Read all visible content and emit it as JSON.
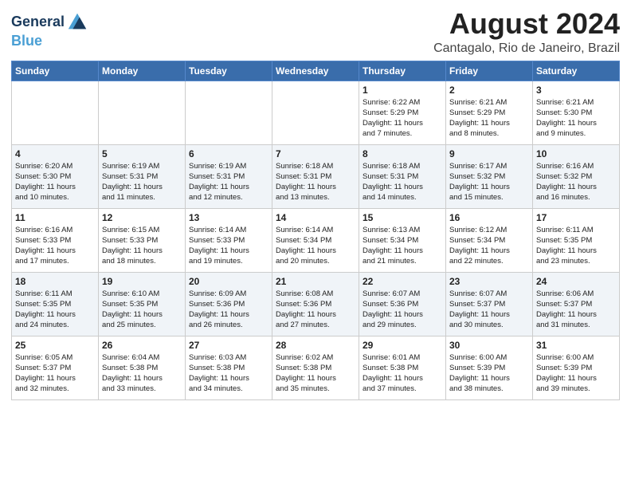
{
  "logo": {
    "line1": "General",
    "line2": "Blue"
  },
  "title": "August 2024",
  "location": "Cantagalo, Rio de Janeiro, Brazil",
  "days_of_week": [
    "Sunday",
    "Monday",
    "Tuesday",
    "Wednesday",
    "Thursday",
    "Friday",
    "Saturday"
  ],
  "weeks": [
    [
      {
        "day": "",
        "info": ""
      },
      {
        "day": "",
        "info": ""
      },
      {
        "day": "",
        "info": ""
      },
      {
        "day": "",
        "info": ""
      },
      {
        "day": "1",
        "info": "Sunrise: 6:22 AM\nSunset: 5:29 PM\nDaylight: 11 hours\nand 7 minutes."
      },
      {
        "day": "2",
        "info": "Sunrise: 6:21 AM\nSunset: 5:29 PM\nDaylight: 11 hours\nand 8 minutes."
      },
      {
        "day": "3",
        "info": "Sunrise: 6:21 AM\nSunset: 5:30 PM\nDaylight: 11 hours\nand 9 minutes."
      }
    ],
    [
      {
        "day": "4",
        "info": "Sunrise: 6:20 AM\nSunset: 5:30 PM\nDaylight: 11 hours\nand 10 minutes."
      },
      {
        "day": "5",
        "info": "Sunrise: 6:19 AM\nSunset: 5:31 PM\nDaylight: 11 hours\nand 11 minutes."
      },
      {
        "day": "6",
        "info": "Sunrise: 6:19 AM\nSunset: 5:31 PM\nDaylight: 11 hours\nand 12 minutes."
      },
      {
        "day": "7",
        "info": "Sunrise: 6:18 AM\nSunset: 5:31 PM\nDaylight: 11 hours\nand 13 minutes."
      },
      {
        "day": "8",
        "info": "Sunrise: 6:18 AM\nSunset: 5:31 PM\nDaylight: 11 hours\nand 14 minutes."
      },
      {
        "day": "9",
        "info": "Sunrise: 6:17 AM\nSunset: 5:32 PM\nDaylight: 11 hours\nand 15 minutes."
      },
      {
        "day": "10",
        "info": "Sunrise: 6:16 AM\nSunset: 5:32 PM\nDaylight: 11 hours\nand 16 minutes."
      }
    ],
    [
      {
        "day": "11",
        "info": "Sunrise: 6:16 AM\nSunset: 5:33 PM\nDaylight: 11 hours\nand 17 minutes."
      },
      {
        "day": "12",
        "info": "Sunrise: 6:15 AM\nSunset: 5:33 PM\nDaylight: 11 hours\nand 18 minutes."
      },
      {
        "day": "13",
        "info": "Sunrise: 6:14 AM\nSunset: 5:33 PM\nDaylight: 11 hours\nand 19 minutes."
      },
      {
        "day": "14",
        "info": "Sunrise: 6:14 AM\nSunset: 5:34 PM\nDaylight: 11 hours\nand 20 minutes."
      },
      {
        "day": "15",
        "info": "Sunrise: 6:13 AM\nSunset: 5:34 PM\nDaylight: 11 hours\nand 21 minutes."
      },
      {
        "day": "16",
        "info": "Sunrise: 6:12 AM\nSunset: 5:34 PM\nDaylight: 11 hours\nand 22 minutes."
      },
      {
        "day": "17",
        "info": "Sunrise: 6:11 AM\nSunset: 5:35 PM\nDaylight: 11 hours\nand 23 minutes."
      }
    ],
    [
      {
        "day": "18",
        "info": "Sunrise: 6:11 AM\nSunset: 5:35 PM\nDaylight: 11 hours\nand 24 minutes."
      },
      {
        "day": "19",
        "info": "Sunrise: 6:10 AM\nSunset: 5:35 PM\nDaylight: 11 hours\nand 25 minutes."
      },
      {
        "day": "20",
        "info": "Sunrise: 6:09 AM\nSunset: 5:36 PM\nDaylight: 11 hours\nand 26 minutes."
      },
      {
        "day": "21",
        "info": "Sunrise: 6:08 AM\nSunset: 5:36 PM\nDaylight: 11 hours\nand 27 minutes."
      },
      {
        "day": "22",
        "info": "Sunrise: 6:07 AM\nSunset: 5:36 PM\nDaylight: 11 hours\nand 29 minutes."
      },
      {
        "day": "23",
        "info": "Sunrise: 6:07 AM\nSunset: 5:37 PM\nDaylight: 11 hours\nand 30 minutes."
      },
      {
        "day": "24",
        "info": "Sunrise: 6:06 AM\nSunset: 5:37 PM\nDaylight: 11 hours\nand 31 minutes."
      }
    ],
    [
      {
        "day": "25",
        "info": "Sunrise: 6:05 AM\nSunset: 5:37 PM\nDaylight: 11 hours\nand 32 minutes."
      },
      {
        "day": "26",
        "info": "Sunrise: 6:04 AM\nSunset: 5:38 PM\nDaylight: 11 hours\nand 33 minutes."
      },
      {
        "day": "27",
        "info": "Sunrise: 6:03 AM\nSunset: 5:38 PM\nDaylight: 11 hours\nand 34 minutes."
      },
      {
        "day": "28",
        "info": "Sunrise: 6:02 AM\nSunset: 5:38 PM\nDaylight: 11 hours\nand 35 minutes."
      },
      {
        "day": "29",
        "info": "Sunrise: 6:01 AM\nSunset: 5:38 PM\nDaylight: 11 hours\nand 37 minutes."
      },
      {
        "day": "30",
        "info": "Sunrise: 6:00 AM\nSunset: 5:39 PM\nDaylight: 11 hours\nand 38 minutes."
      },
      {
        "day": "31",
        "info": "Sunrise: 6:00 AM\nSunset: 5:39 PM\nDaylight: 11 hours\nand 39 minutes."
      }
    ]
  ]
}
